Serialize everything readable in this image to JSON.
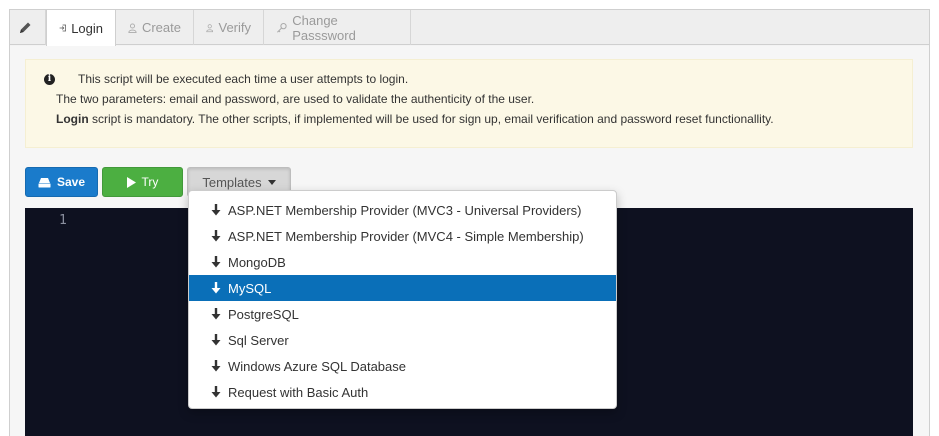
{
  "tabs": {
    "login": "Login",
    "create": "Create",
    "verify": "Verify",
    "change_password": "Change Passsword"
  },
  "notice": {
    "line1": "This script will be executed each time a user attempts to login.",
    "line2": "The two parameters: email and password, are used to validate the authenticity of the user.",
    "line3_bold": "Login",
    "line3_rest": " script is mandatory. The other scripts, if implemented will be used for sign up, email verification and password reset functionallity."
  },
  "toolbar": {
    "save_label": "Save",
    "try_label": "Try",
    "templates_label": "Templates"
  },
  "editor": {
    "line_number": "1"
  },
  "templates_menu": {
    "items": [
      "ASP.NET Membership Provider (MVC3 - Universal Providers)",
      "ASP.NET Membership Provider (MVC4 - Simple Membership)",
      "MongoDB",
      "MySQL",
      "PostgreSQL",
      "Sql Server",
      "Windows Azure SQL Database",
      "Request with Basic Auth"
    ],
    "selected": "MySQL"
  },
  "colors": {
    "save": "#1a7bcb",
    "try": "#4caf41",
    "selected_item": "#0a6fb8",
    "editor_bg": "#0e1120",
    "notice_bg": "#fcf8e6"
  }
}
